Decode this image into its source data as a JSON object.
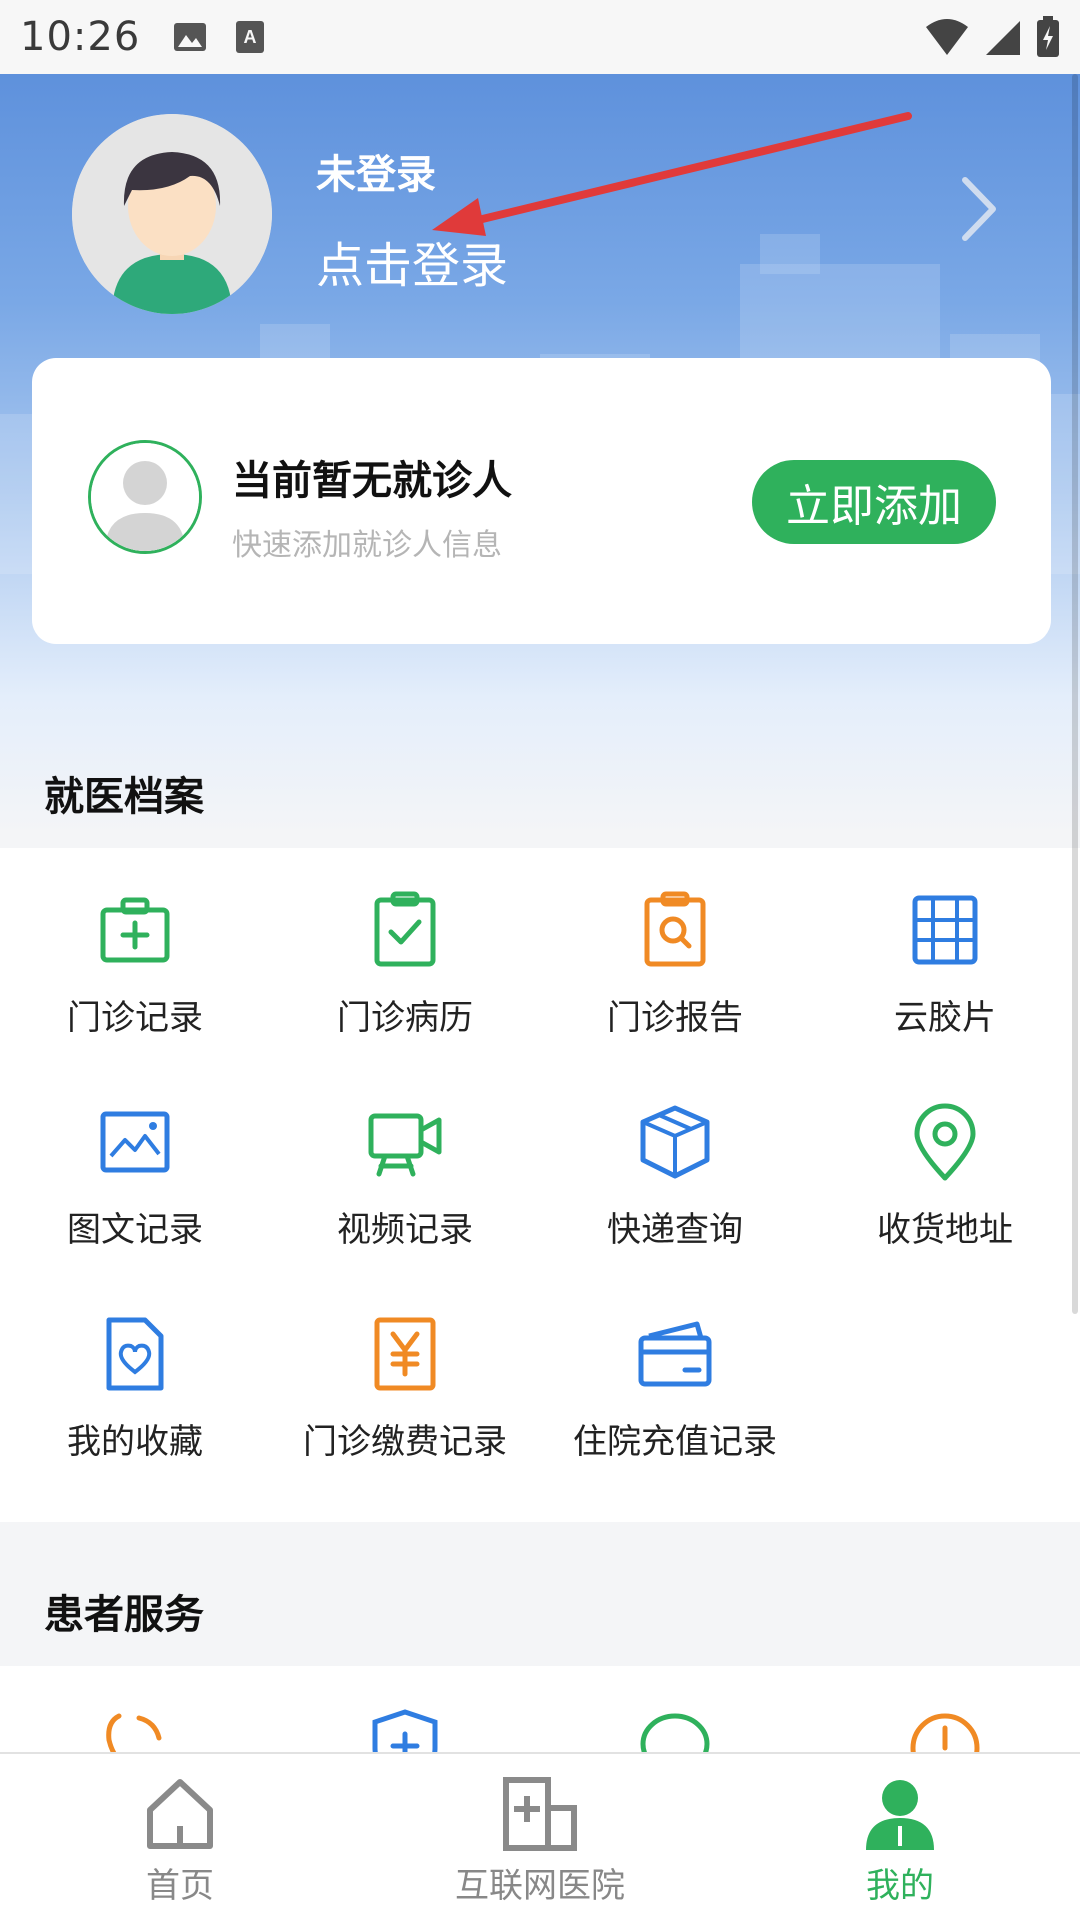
{
  "status_bar": {
    "time": "10:26"
  },
  "header": {
    "login_status": "未登录",
    "login_link": "点击登录"
  },
  "patient_card": {
    "title": "当前暂无就诊人",
    "subtitle": "快速添加就诊人信息",
    "add_button": "立即添加"
  },
  "records": {
    "title": "就医档案",
    "items": [
      {
        "label": "门诊记录",
        "icon": "medical-kit-icon",
        "color": "#2fb15c"
      },
      {
        "label": "门诊病历",
        "icon": "clipboard-check-icon",
        "color": "#2fb15c"
      },
      {
        "label": "门诊报告",
        "icon": "clipboard-search-icon",
        "color": "#f08a24"
      },
      {
        "label": "云胶片",
        "icon": "film-icon",
        "color": "#2f7de1"
      },
      {
        "label": "图文记录",
        "icon": "image-icon",
        "color": "#2f7de1"
      },
      {
        "label": "视频记录",
        "icon": "video-icon",
        "color": "#2fb15c"
      },
      {
        "label": "快递查询",
        "icon": "package-icon",
        "color": "#2f7de1"
      },
      {
        "label": "收货地址",
        "icon": "location-pin-icon",
        "color": "#2fb15c"
      },
      {
        "label": "我的收藏",
        "icon": "heart-doc-icon",
        "color": "#2f7de1"
      },
      {
        "label": "门诊缴费记录",
        "icon": "yen-receipt-icon",
        "color": "#f08a24"
      },
      {
        "label": "住院充值记录",
        "icon": "card-icon",
        "color": "#2f7de1"
      }
    ]
  },
  "services": {
    "title": "患者服务"
  },
  "bottom_nav": {
    "items": [
      {
        "label": "首页",
        "icon": "home-icon"
      },
      {
        "label": "互联网医院",
        "icon": "hospital-icon"
      },
      {
        "label": "我的",
        "icon": "user-icon",
        "active": true
      }
    ]
  },
  "colors": {
    "accent_green": "#2fb15c",
    "accent_blue": "#2f7de1",
    "accent_orange": "#f08a24"
  }
}
